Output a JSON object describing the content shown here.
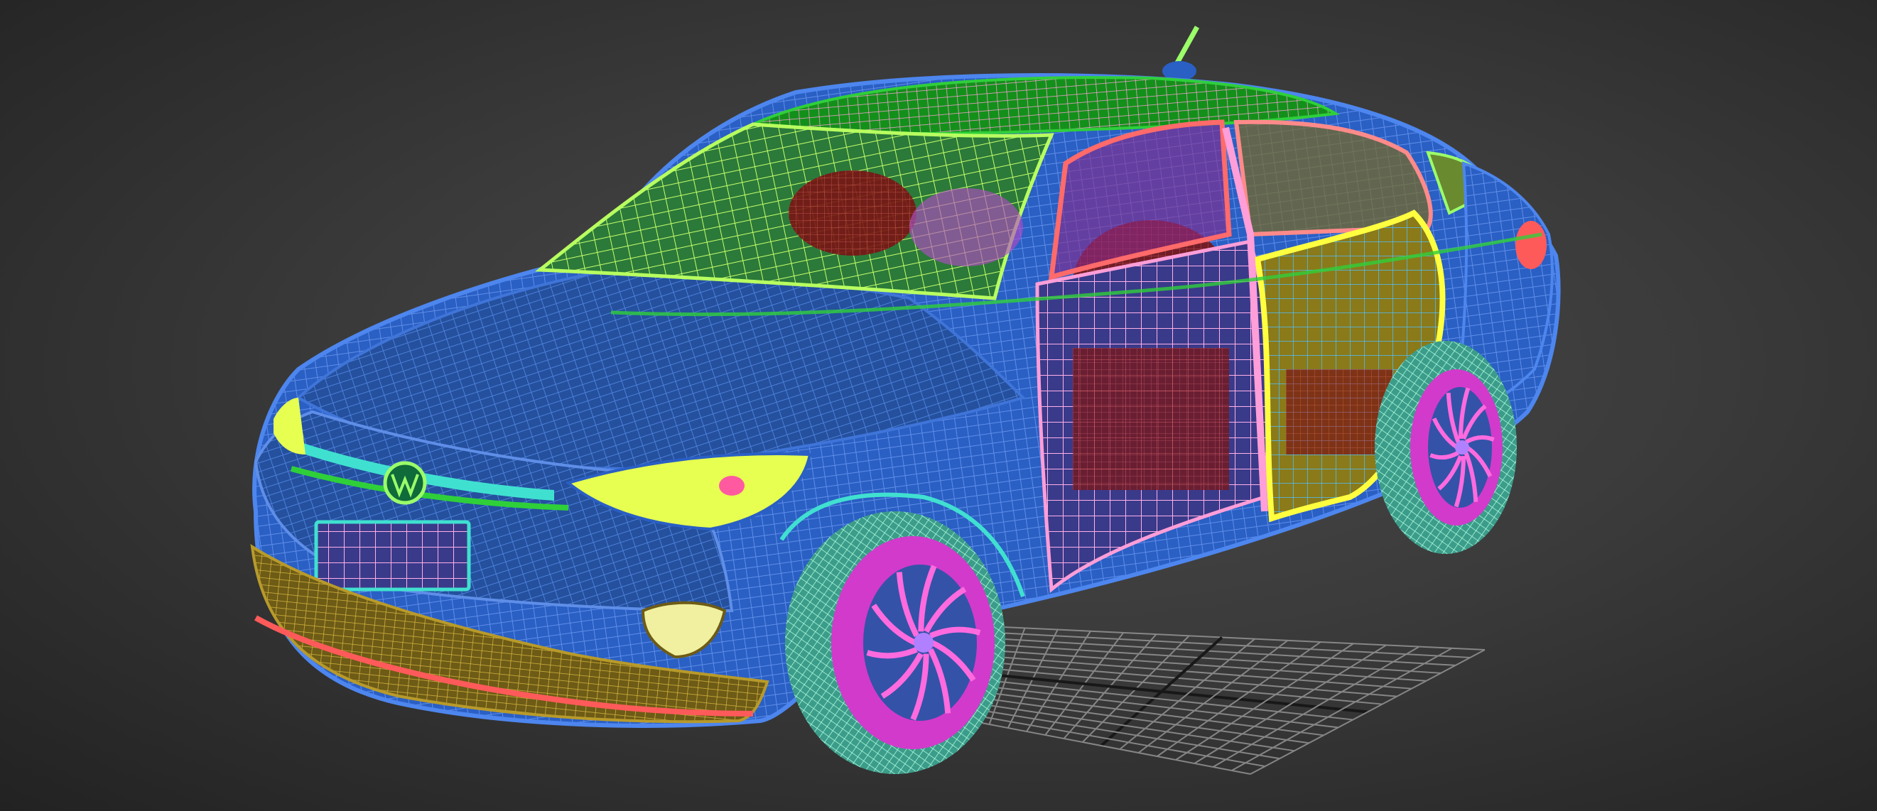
{
  "viewport": {
    "mode": "wireframe",
    "background": "#3b3b3b"
  },
  "model": {
    "subject": "sedan car",
    "badge_icon": "vw-logo-icon",
    "colors": {
      "body": "#2a5fc4",
      "roof": "#1aa51a",
      "glass": "#9be85a",
      "trim": "#ff9ed8",
      "wheel": "#d23acb",
      "tire": "#8ff0c8",
      "interior": "#8b1b1b",
      "bumper": "#b89a2a",
      "highlight": "#ffff40",
      "light": "#e6ff50",
      "tail": "#ff5a5a",
      "cyan": "#40e0d0"
    }
  },
  "ground_grid": {
    "visible": true,
    "color": "#9a9a9a",
    "axis_color": "#111111"
  }
}
